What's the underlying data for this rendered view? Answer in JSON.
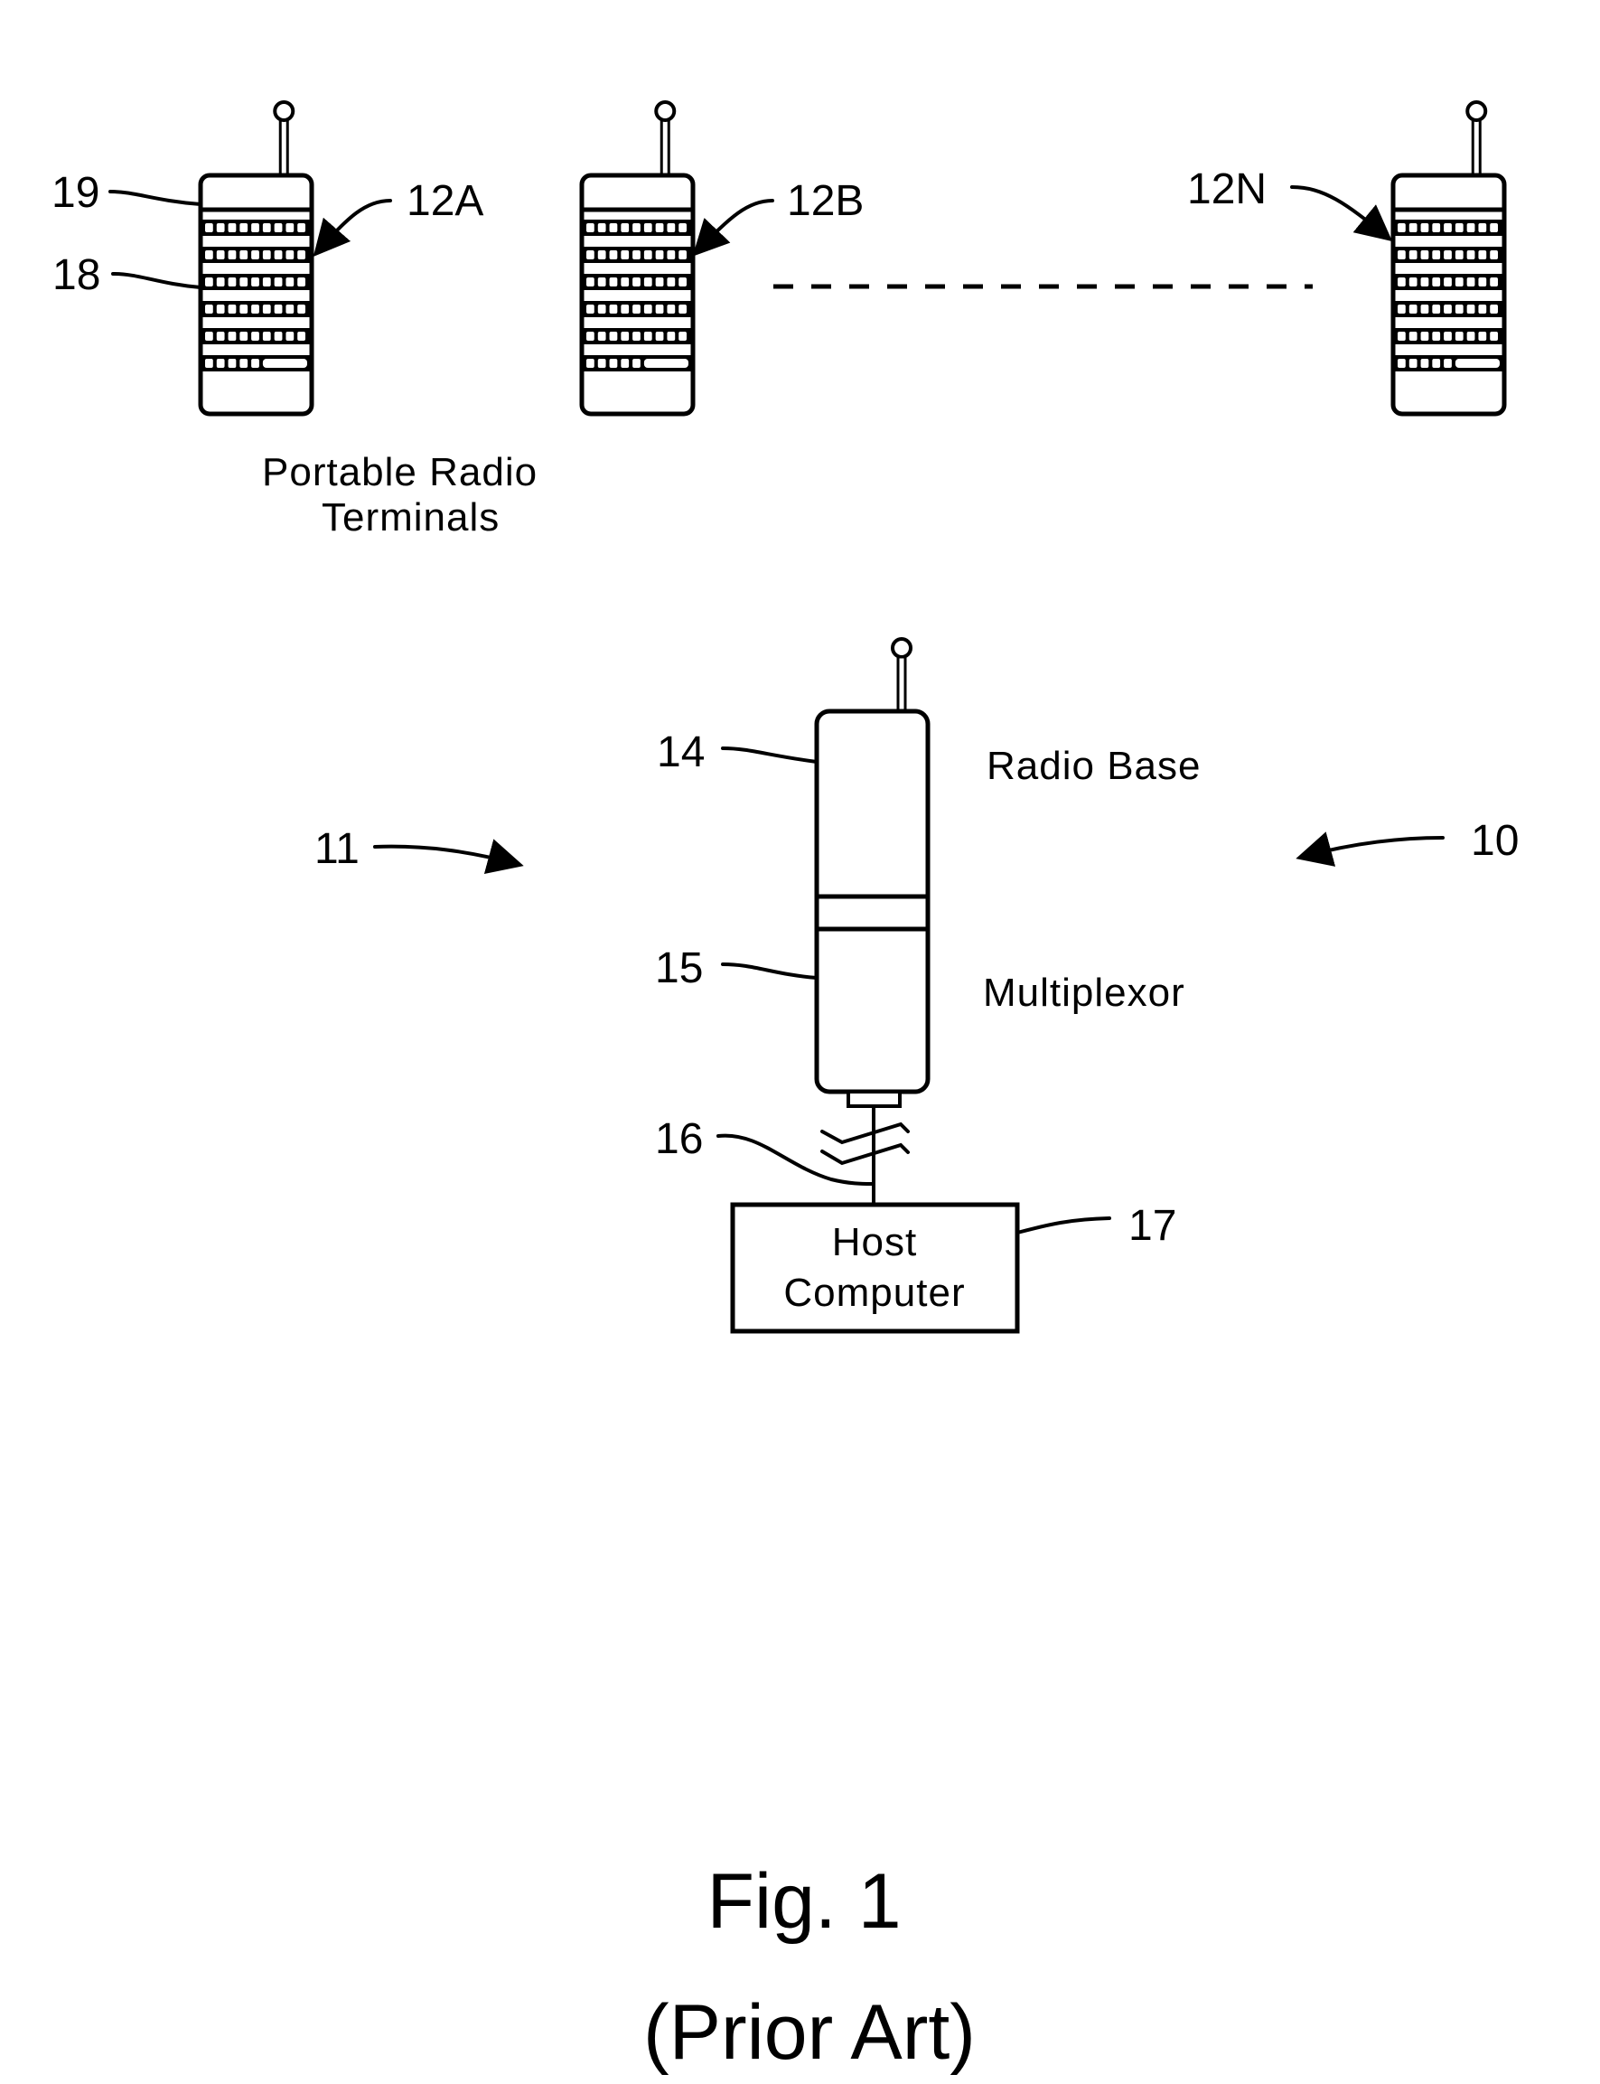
{
  "figure": {
    "title": "Fig. 1",
    "subtitle": "(Prior Art)"
  },
  "colors": {
    "ink": "#000000",
    "paper": "#ffffff"
  },
  "terminals": {
    "caption_line1": "Portable Radio",
    "caption_line2": "Terminals",
    "items": [
      {
        "ref": "12A"
      },
      {
        "ref": "12B"
      },
      {
        "ref": "12N"
      }
    ],
    "display_ref": "19",
    "keypad_ref": "18",
    "keys_per_row": 9,
    "key_rows": 6,
    "last_row_keys": 5
  },
  "base_station": {
    "radio_ref": "14",
    "radio_label": "Radio Base",
    "mux_ref": "15",
    "mux_label": "Multiplexor",
    "cable_ref": "16"
  },
  "host": {
    "ref": "17",
    "line1": "Host",
    "line2": "Computer"
  },
  "system_refs": {
    "left": "11",
    "right": "10"
  }
}
